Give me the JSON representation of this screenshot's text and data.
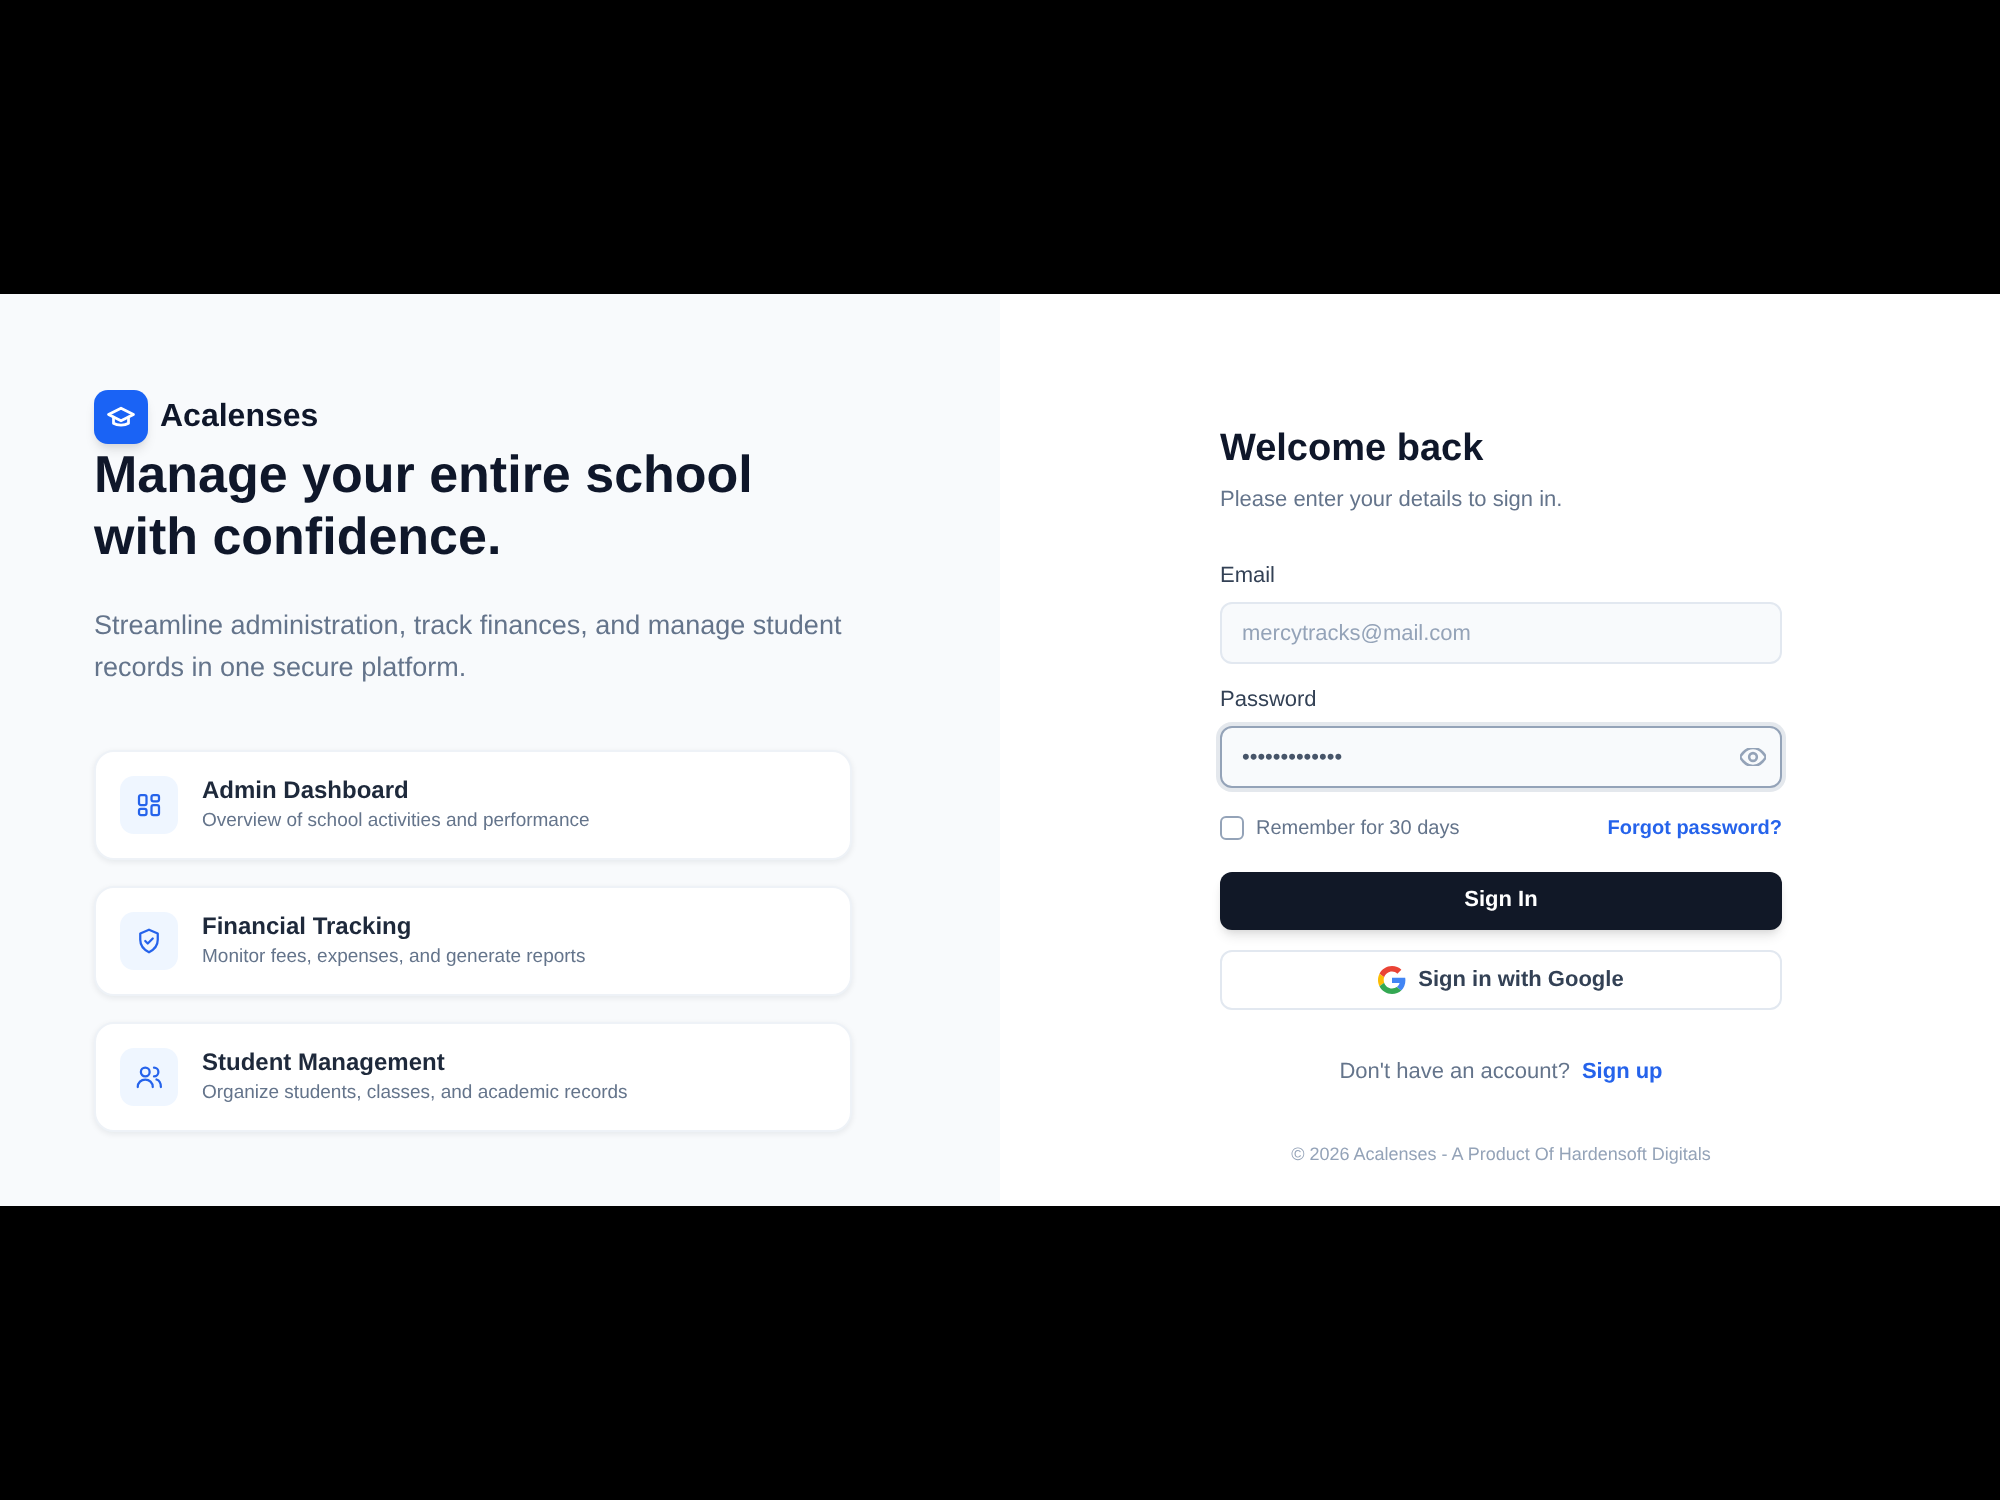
{
  "brand": {
    "name": "Acalenses"
  },
  "hero": {
    "title": "Manage your entire school with confidence.",
    "subtitle": "Streamline administration, track finances, and manage student records in one secure platform."
  },
  "features": [
    {
      "title": "Admin Dashboard",
      "description": "Overview of school activities and performance"
    },
    {
      "title": "Financial Tracking",
      "description": "Monitor fees, expenses, and generate reports"
    },
    {
      "title": "Student Management",
      "description": "Organize students, classes, and academic records"
    }
  ],
  "login": {
    "title": "Welcome back",
    "subtitle": "Please enter your details to sign in.",
    "fields": [
      {
        "kind": "email",
        "label": "Email",
        "placeholder": "mercytracks@mail.com",
        "focused": false
      },
      {
        "kind": "password",
        "label": "Password",
        "value": "•••••••••••••",
        "focused": true
      }
    ],
    "remember": {
      "label": "Remember for 30 days",
      "checked": false
    },
    "forgot_link": "Forgot password?",
    "primary_button": "Sign In",
    "google_button": "Sign in with Google",
    "signup": {
      "prompt": "Don't have an account?",
      "link": "Sign up"
    },
    "footer": "© 2026 Acalenses - A Product Of Hardensoft Digitals"
  }
}
